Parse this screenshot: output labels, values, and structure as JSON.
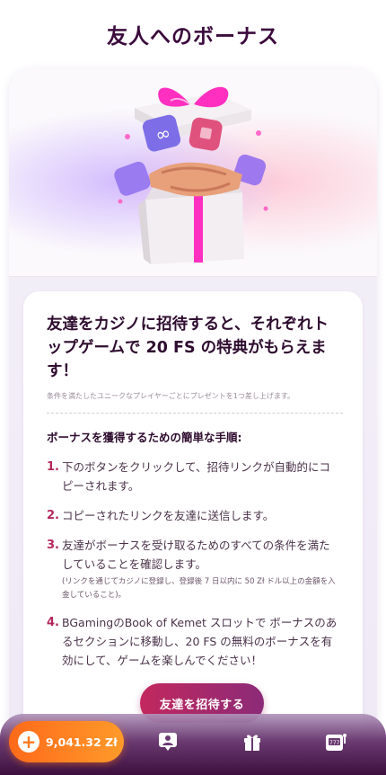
{
  "header": {
    "title": "友人へのボーナス"
  },
  "hero": {
    "image": "gift-box-handshake-illustration"
  },
  "info": {
    "headline": "友達をカジノに招待すると、それぞれトップゲームで 20 FS の特典がもらえます！",
    "subnote": "条件を満たしたユニークなプレイヤーごとにプレゼントを1つ差し上げます。",
    "steps_title": "ボーナスを獲得するための簡単な手順:",
    "steps": [
      {
        "num": "1.",
        "text": "下のボタンをクリックして、招待リンクが自動的にコピーされます。",
        "note": ""
      },
      {
        "num": "2.",
        "text": "コピーされたリンクを友達に送信します。",
        "note": ""
      },
      {
        "num": "3.",
        "text": "友達がボーナスを受け取るためのすべての条件を満たしていることを確認します。",
        "note": "(リンクを通じてカジノに登録し、登録後 7 日以内に 50 Zł ドル以上の金額を入金していること)。"
      },
      {
        "num": "4.",
        "text": "BGamingのBook of Kemet スロットで ボーナスのあるセクションに移動し、20 FS の無料のボーナスを有効にして、ゲームを楽しんでください！",
        "note": ""
      }
    ],
    "invite_button": "友達を招待する"
  },
  "bottom_nav": {
    "balance": "9,041.32 Zł",
    "icons": [
      "plus-icon",
      "profile-badge-icon",
      "gift-icon",
      "slot-machine-icon"
    ]
  },
  "colors": {
    "title": "#3b0b3c",
    "accent": "#c2285d",
    "balance": "#ff7a1f",
    "nav_bg": "#3c0f3d"
  }
}
